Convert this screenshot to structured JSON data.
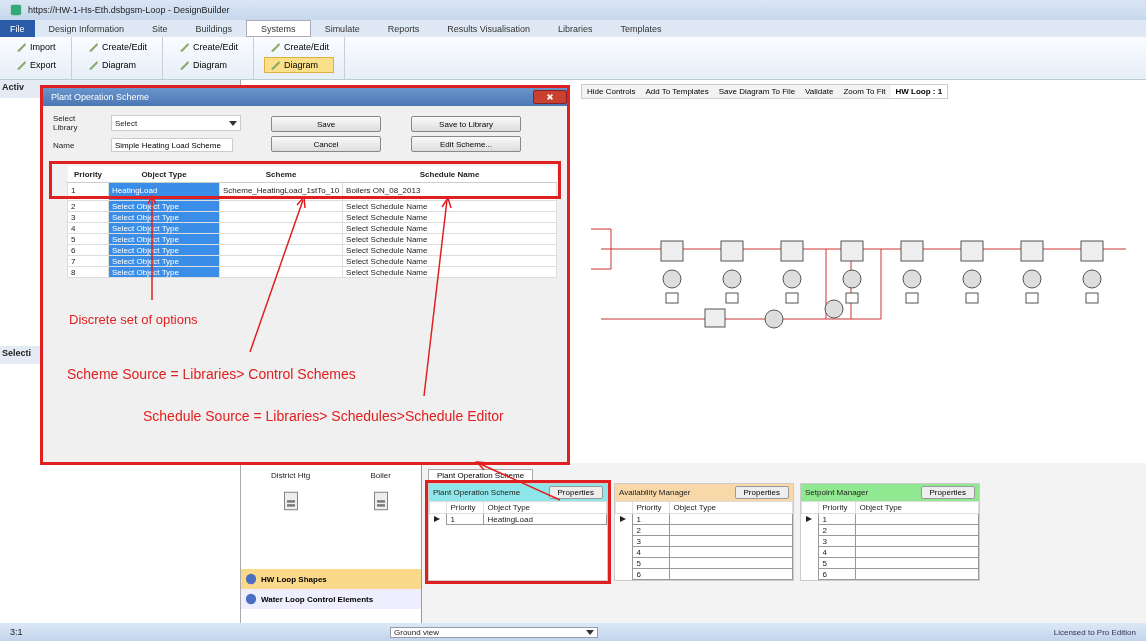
{
  "window": {
    "title": "https://HW-1-Hs-Eth.dsbgsm-Loop - DesignBuilder"
  },
  "menu_tabs": [
    {
      "label": "File",
      "selected": false,
      "kind": "file"
    },
    {
      "label": "Design Information",
      "selected": false,
      "kind": "tab"
    },
    {
      "label": "Site",
      "selected": false,
      "kind": "tab"
    },
    {
      "label": "Buildings",
      "selected": false,
      "kind": "tab"
    },
    {
      "label": "Systems",
      "selected": true,
      "kind": "tab"
    },
    {
      "label": "Simulate",
      "selected": false,
      "kind": "tab"
    },
    {
      "label": "Reports",
      "selected": false,
      "kind": "tab"
    },
    {
      "label": "Results Visualisation",
      "selected": false,
      "kind": "tab"
    },
    {
      "label": "Libraries",
      "selected": false,
      "kind": "tab"
    },
    {
      "label": "Templates",
      "selected": false,
      "kind": "tab"
    }
  ],
  "ribbon": [
    {
      "items": [
        {
          "label": "Import",
          "selected": false
        },
        {
          "label": "Export",
          "selected": false
        }
      ]
    },
    {
      "items": [
        {
          "label": "Create/Edit",
          "selected": false
        },
        {
          "label": "Diagram",
          "selected": false
        }
      ]
    },
    {
      "items": [
        {
          "label": "Create/Edit",
          "selected": false
        },
        {
          "label": "Diagram",
          "selected": false
        }
      ]
    },
    {
      "items": [
        {
          "label": "Create/Edit",
          "selected": false
        },
        {
          "label": "Diagram",
          "selected": true
        }
      ]
    }
  ],
  "left_panel": {
    "top_label": "Activ",
    "bottom_label": "Selecti"
  },
  "diagram_toolbar": [
    {
      "label": "Hide Controls",
      "selected": false
    },
    {
      "label": "Add To Templates",
      "selected": false
    },
    {
      "label": "Save Diagram To File",
      "selected": false
    },
    {
      "label": "Validate",
      "selected": false
    },
    {
      "label": "Zoom To Fit",
      "selected": false
    },
    {
      "label": "HW Loop : 1",
      "selected": true
    }
  ],
  "dialog": {
    "title": "Plant Operation Scheme",
    "library_label": "Select Library",
    "library_value": "Select",
    "name_label": "Name",
    "name_value": "Simple Heating Load Scheme",
    "buttons": [
      "Save",
      "Save to Library",
      "Cancel",
      "Edit Scheme..."
    ],
    "columns": [
      "Priority",
      "Object Type",
      "Scheme",
      "Schedule Name"
    ],
    "rows": [
      {
        "priority": "1",
        "object_type": "HeatingLoad",
        "scheme": "Scheme_HeatingLoad_1stTo_10",
        "schedule": "Boilers ON_08_2013",
        "selected": true
      },
      {
        "priority": "2",
        "object_type": "Select Object Type",
        "scheme": "",
        "schedule": "Select Schedule Name",
        "selected": true
      },
      {
        "priority": "3",
        "object_type": "Select Object Type",
        "scheme": "",
        "schedule": "Select Schedule Name",
        "selected": true
      },
      {
        "priority": "4",
        "object_type": "Select Object Type",
        "scheme": "",
        "schedule": "Select Schedule Name",
        "selected": true
      },
      {
        "priority": "5",
        "object_type": "Select Object Type",
        "scheme": "",
        "schedule": "Select Schedule Name",
        "selected": true
      },
      {
        "priority": "6",
        "object_type": "Select Object Type",
        "scheme": "",
        "schedule": "Select Schedule Name",
        "selected": true
      },
      {
        "priority": "7",
        "object_type": "Select Object Type",
        "scheme": "",
        "schedule": "Select Schedule Name",
        "selected": true
      },
      {
        "priority": "8",
        "object_type": "Select Object Type",
        "scheme": "",
        "schedule": "Select Schedule Name",
        "selected": true
      }
    ],
    "annotations": [
      "Discrete set of options",
      "Scheme Source = Libraries> Control Schemes",
      "Schedule Source = Libraries> Schedules>Schedule Editor"
    ]
  },
  "palette": {
    "items": [
      "District Htg",
      "Boiler"
    ],
    "sections": [
      {
        "label": "HW Loop Shapes",
        "selected": true
      },
      {
        "label": "Water Loop Control Elements",
        "selected": false
      }
    ]
  },
  "bottom_tab": "Plant Operation Scheme",
  "managers": [
    {
      "title": "Plant Operation Scheme",
      "color": "#8fe6ea",
      "button": "Properties",
      "columns": [
        "Priority",
        "Object Type"
      ],
      "rows": [
        {
          "priority": "1",
          "object_type": "HeatingLoad"
        }
      ]
    },
    {
      "title": "Availability Manager",
      "color": "#f8d8a8",
      "button": "Properties",
      "columns": [
        "Priority",
        "Object Type"
      ],
      "rows": [
        {
          "priority": "1",
          "object_type": ""
        },
        {
          "priority": "2",
          "object_type": ""
        },
        {
          "priority": "3",
          "object_type": ""
        },
        {
          "priority": "4",
          "object_type": ""
        },
        {
          "priority": "5",
          "object_type": ""
        },
        {
          "priority": "6",
          "object_type": ""
        }
      ]
    },
    {
      "title": "Setpoint Manager",
      "color": "#90e890",
      "button": "Properties",
      "columns": [
        "Priority",
        "Object Type"
      ],
      "rows": [
        {
          "priority": "1",
          "object_type": ""
        },
        {
          "priority": "2",
          "object_type": ""
        },
        {
          "priority": "3",
          "object_type": ""
        },
        {
          "priority": "4",
          "object_type": ""
        },
        {
          "priority": "5",
          "object_type": ""
        },
        {
          "priority": "6",
          "object_type": ""
        }
      ]
    }
  ],
  "status_bar": {
    "left": "3:1",
    "view": "Ground view",
    "right": "Licensed to Pro Edition"
  }
}
